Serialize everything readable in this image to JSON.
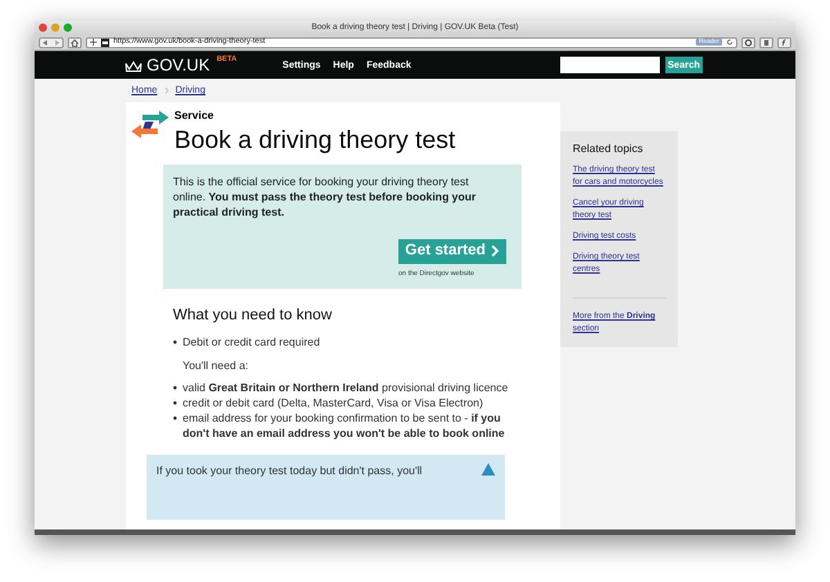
{
  "window": {
    "title": "Book a driving theory test | Driving | GOV.UK Beta (Test)"
  },
  "toolbar": {
    "url": "https://www.gov.uk/book-a-driving-theory-test",
    "reader": "Reader"
  },
  "header": {
    "logo": "GOV.UK",
    "badge": "BETA",
    "nav": [
      "Settings",
      "Help",
      "Feedback"
    ],
    "search_button": "Search"
  },
  "breadcrumbs": [
    "Home",
    "Driving"
  ],
  "page": {
    "kicker": "Service",
    "title": "Book a driving theory test",
    "intro": "This is the official service for booking your driving theory test online. **You must pass the theory test before booking your practical driving test.**",
    "button": "Get started",
    "button_note": "on the Directgov website",
    "heading": "What you need to know",
    "list1": [
      "Debit or credit card required"
    ],
    "lead": "You'll need a:",
    "list2": [
      "valid **Great Britain or Northern Ireland** provisional driving licence",
      "credit or debit card (Delta, MasterCard, Visa or Visa Electron)",
      "email address for your booking confirmation to be sent to - **if you don't have an email address you won't be able to book online**"
    ],
    "notice": "If you took your theory test today but didn't pass, you'll"
  },
  "sidebar": {
    "title": "Related topics",
    "links": [
      "The driving theory test for cars and motorcycles",
      "Cancel your driving theory test",
      "Driving test costs",
      "Driving theory test centres"
    ],
    "more": "More from the **Driving** section"
  }
}
